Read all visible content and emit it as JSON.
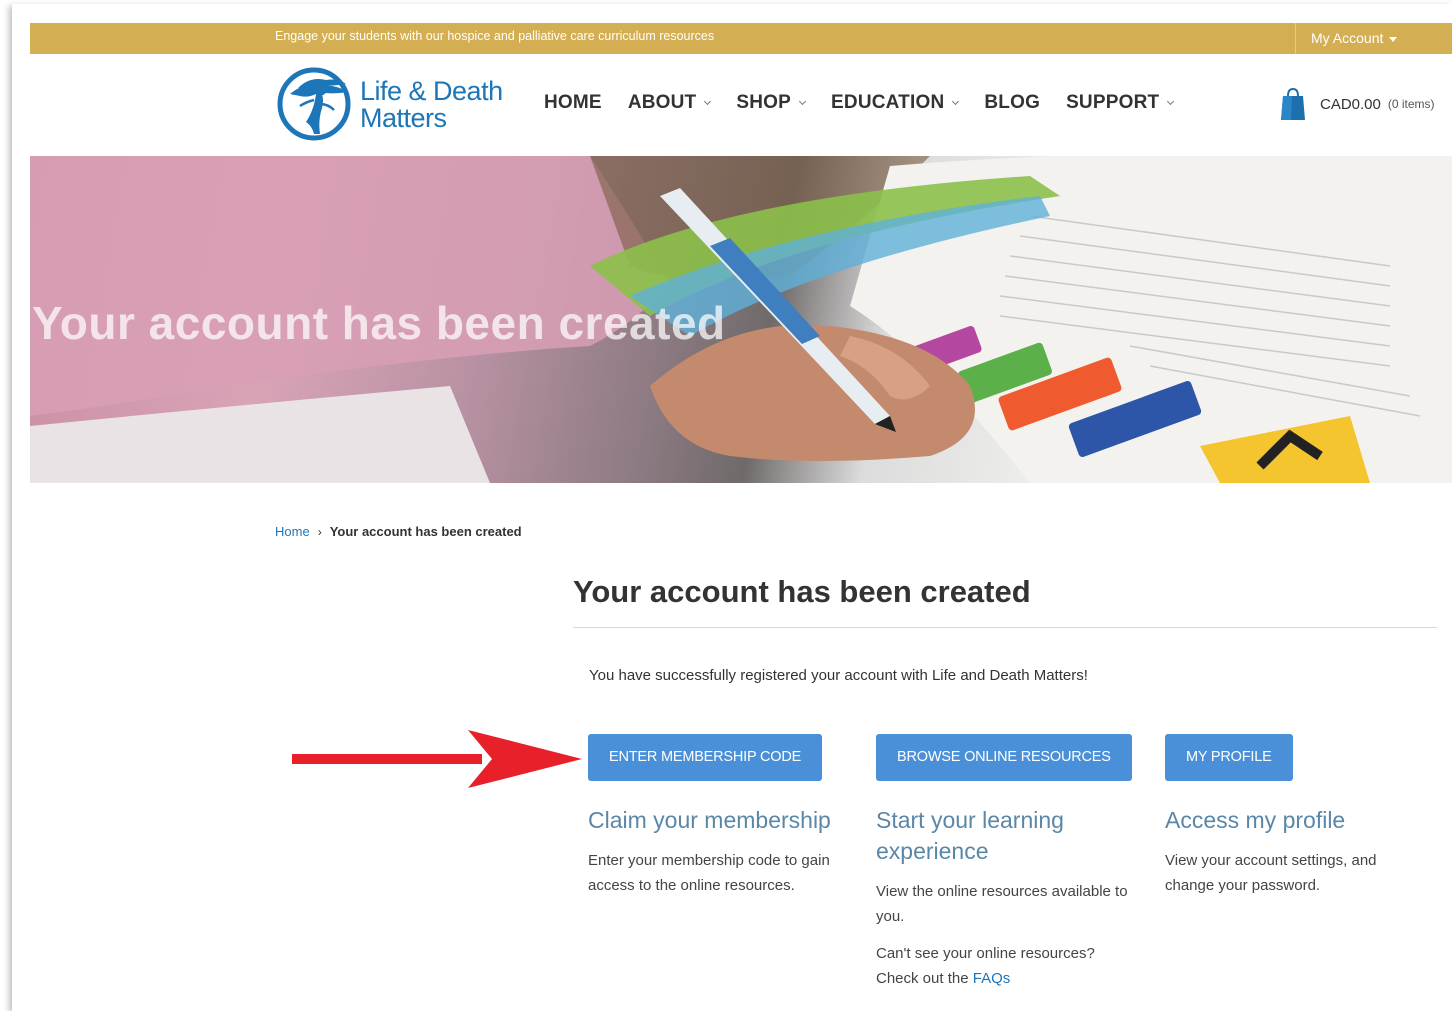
{
  "topbar": {
    "tagline": "Engage your students with our hospice and palliative care curriculum resources",
    "my_account": "My Account"
  },
  "header": {
    "logo_line1": "Life & Death",
    "logo_line2": "Matters",
    "nav": [
      {
        "label": "HOME",
        "dropdown": false
      },
      {
        "label": "ABOUT",
        "dropdown": true
      },
      {
        "label": "SHOP",
        "dropdown": true
      },
      {
        "label": "EDUCATION",
        "dropdown": true
      },
      {
        "label": "BLOG",
        "dropdown": false
      },
      {
        "label": "SUPPORT",
        "dropdown": true
      }
    ],
    "cart_amount": "CAD0.00",
    "cart_items": "(0 items)"
  },
  "hero": {
    "title": "Your account has been created"
  },
  "breadcrumb": {
    "home": "Home",
    "separator": "›",
    "current": "Your account has been created"
  },
  "main": {
    "title": "Your account has been created",
    "intro": "You have successfully registered your account with Life and Death Matters!",
    "columns": [
      {
        "button": "ENTER MEMBERSHIP CODE",
        "heading": "Claim your membership",
        "text": "Enter your membership code to gain access to the online resources."
      },
      {
        "button": "BROWSE ONLINE RESOURCES",
        "heading": "Start your learning experience",
        "text": "View the online resources available to you.",
        "extra_text": "Can't see your online resources? Check out the",
        "extra_link": "FAQs"
      },
      {
        "button": "MY PROFILE",
        "heading": "Access my profile",
        "text": "View your account settings, and change your password."
      }
    ]
  },
  "colors": {
    "topbar": "#d4ae52",
    "brand_blue": "#1d76b7",
    "button_blue": "#4a90d9",
    "heading_blue": "#5a87a8",
    "annotation_arrow": "#e8202a"
  },
  "icons": [
    "logo-tree-icon",
    "shopping-bag-icon",
    "chevron-down-icon",
    "caret-down-icon",
    "annotation-arrow-icon"
  ]
}
